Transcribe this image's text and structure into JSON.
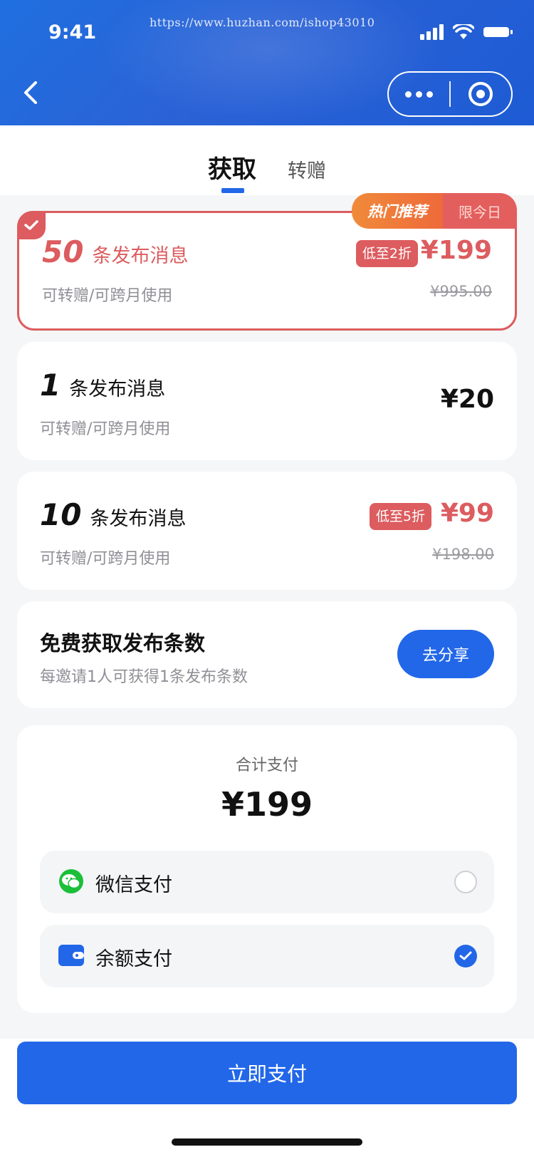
{
  "status_bar": {
    "time": "9:41",
    "watermark": "https://www.huzhan.com/ishop43010"
  },
  "tabs": {
    "active": "获取",
    "other": "转赠"
  },
  "packages": [
    {
      "count": "50",
      "label": "条发布消息",
      "sub": "可转赠/可跨月使用",
      "discount": "低至2折",
      "price": "¥199",
      "original": "¥995.00",
      "ribbon_left": "热门推荐",
      "ribbon_right": "限今日",
      "selected": true
    },
    {
      "count": "1",
      "label": "条发布消息",
      "sub": "可转赠/可跨月使用",
      "price": "¥20"
    },
    {
      "count": "10",
      "label": "条发布消息",
      "sub": "可转赠/可跨月使用",
      "discount": "低至5折",
      "price": "¥99",
      "original": "¥198.00"
    }
  ],
  "free": {
    "title": "免费获取发布条数",
    "sub": "每邀请1人可获得1条发布条数",
    "button": "去分享"
  },
  "payment": {
    "title": "合计支付",
    "total": "¥199",
    "options": [
      {
        "name": "微信支付",
        "icon": "wechat-icon",
        "selected": false
      },
      {
        "name": "余额支付",
        "icon": "wallet-icon",
        "selected": true
      }
    ]
  },
  "action": {
    "pay_label": "立即支付"
  },
  "colors": {
    "primary": "#2267e8",
    "accent_red": "#dc5c5f",
    "hot_orange": "#ee6a3a",
    "wechat_green": "#1bbf3a"
  }
}
